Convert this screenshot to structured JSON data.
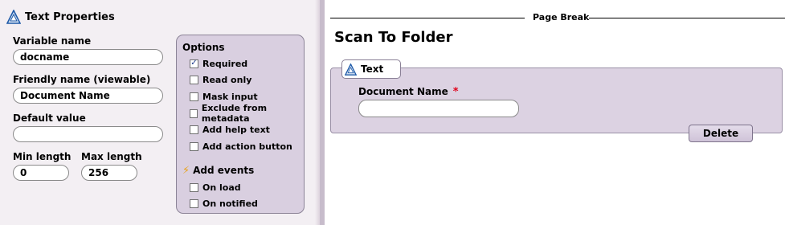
{
  "left_panel": {
    "title": "Text Properties",
    "fields": {
      "variable_name": {
        "label": "Variable name",
        "value": "docname"
      },
      "friendly_name": {
        "label": "Friendly name (viewable)",
        "value": "Document Name"
      },
      "default_value": {
        "label": "Default value",
        "value": ""
      },
      "min_length": {
        "label": "Min length",
        "value": "0"
      },
      "max_length": {
        "label": "Max length",
        "value": "256"
      }
    },
    "options": {
      "title": "Options",
      "items": [
        {
          "label": "Required",
          "checked": true
        },
        {
          "label": "Read only",
          "checked": false
        },
        {
          "label": "Mask input",
          "checked": false
        },
        {
          "label": "Exclude from metadata",
          "checked": false
        },
        {
          "label": "Add help text",
          "checked": false
        },
        {
          "label": "Add action button",
          "checked": false
        }
      ],
      "events_title": "Add events",
      "events": [
        {
          "label": "On load",
          "checked": false
        },
        {
          "label": "On notified",
          "checked": false
        }
      ]
    },
    "check_mark": "✓"
  },
  "right_panel": {
    "page_break_label": "Page Break",
    "form_title": "Scan To Folder",
    "text_group": {
      "tab_label": "Text",
      "field_label": "Document Name",
      "required_mark": "*",
      "field_value": "",
      "delete_label": "Delete"
    }
  },
  "colors": {
    "panel_bg": "#f3eff3",
    "options_bg": "#d9cfe0",
    "group_bg": "#dcd2e2",
    "required_red": "#e0001a",
    "accent_blue": "#1e5aa8"
  },
  "icons": {
    "title_icon": "app-logo-icon",
    "tab_icon": "app-logo-icon",
    "events_icon": "lightning-icon"
  }
}
